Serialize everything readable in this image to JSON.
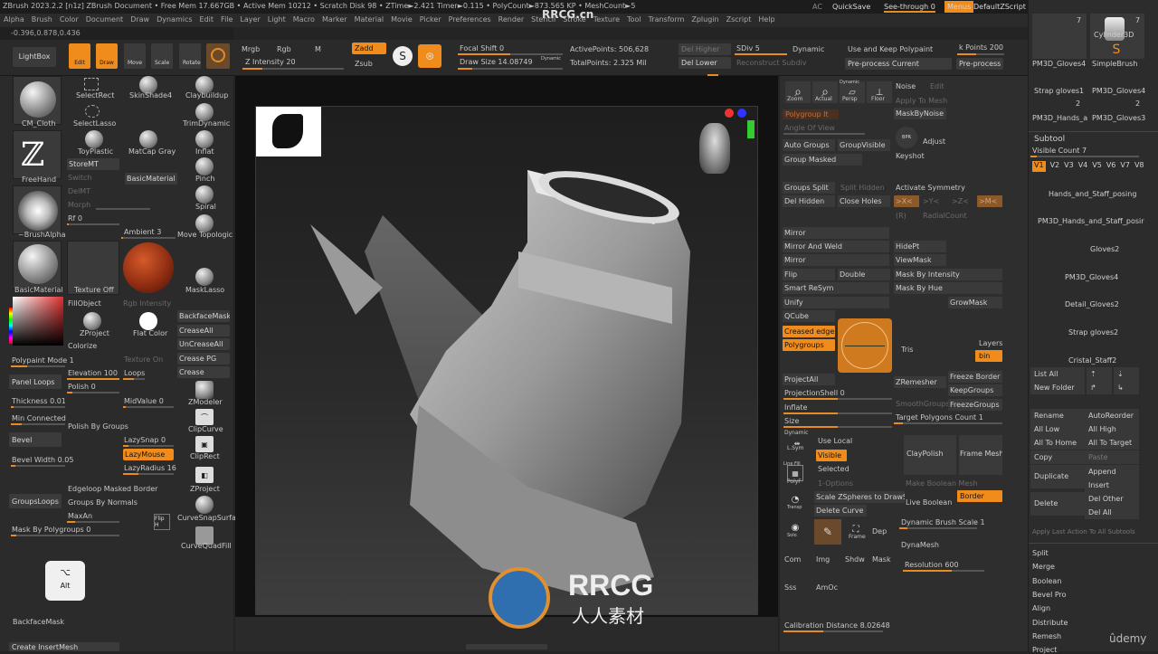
{
  "titlebar": {
    "text": "ZBrush 2023.2.2 [n1z]  ZBrush Document   • Free Mem 17.667GB • Active Mem 10212 • Scratch Disk 98 • ZTime►2.421 Timer►0.115 • PolyCount►873.565 KP • MeshCount►5",
    "ac": "AC",
    "quicksave": "QuickSave",
    "seethrough": "See-through",
    "seethrough_value": "0",
    "menus": "Menus",
    "defaultzscript": "DefaultZScript"
  },
  "menubar": [
    "Alpha",
    "Brush",
    "Color",
    "Document",
    "Draw",
    "Dynamics",
    "Edit",
    "File",
    "Layer",
    "Light",
    "Macro",
    "Marker",
    "Material",
    "Movie",
    "Picker",
    "Preferences",
    "Render",
    "Stencil",
    "Stroke",
    "Texture",
    "Tool",
    "Transform",
    "Zplugin",
    "Zscript",
    "Help"
  ],
  "coords": "-0.396,0.878,0.436",
  "toolbar": {
    "lightbox": "LightBox",
    "edit": "Edit",
    "draw": "Draw",
    "move": "Move",
    "scale": "Scale",
    "rotate": "Rotate",
    "mrgb": "Mrgb",
    "rgb": "Rgb",
    "m": "M",
    "zadd": "Zadd",
    "zsub": "Zsub",
    "z_intensity": "Z Intensity 20",
    "focal_shift": "Focal Shift 0",
    "draw_size": "Draw Size 14.08749",
    "dynamic_small": "Dynamic",
    "active_points": "ActivePoints: 506,628",
    "total_points": "TotalPoints: 2.325 Mil",
    "del_higher": "Del Higher",
    "del_lower": "Del Lower",
    "sdiv": "SDiv 5",
    "dynamic": "Dynamic",
    "reconstruct": "Reconstruct Subdiv",
    "use_keep_polypaint": "Use and Keep Polypaint",
    "preprocess_current": "Pre-process Current",
    "k_points": "k Points 200",
    "preprocess": "Pre-process /"
  },
  "left": {
    "cm_cloth": "CM_Cloth",
    "select_rect": "SelectRect",
    "skinshade4": "SkinShade4",
    "claybuildup": "Claybuildup",
    "select_lasso": "SelectLasso",
    "trimdynamic": "TrimDynamic",
    "freehand": "FreeHand",
    "toyplastic": "ToyPlastic",
    "matcapgray": "MatCap Gray",
    "inflat": "Inflat",
    "storemt": "StoreMT",
    "switch": "Switch",
    "basicmaterial": "BasicMaterial",
    "pinch": "Pinch",
    "delmt": "DelMT",
    "morph": "Morph",
    "spiral": "Spiral",
    "rf": "Rf 0",
    "brushalpha": "~BrushAlpha",
    "ambient": "Ambient 3",
    "move_topologic": "Move Topologic",
    "basicmaterial2": "BasicMaterial",
    "texture_off": "Texture Off",
    "masklasso": "MaskLasso",
    "fillobject": "FillObject",
    "rgb_intensity": "Rgb Intensity",
    "zproject": "ZProject",
    "flat_color": "Flat Color",
    "backfacemask": "BackfaceMask",
    "colorize": "Colorize",
    "crease_all": "CreaseAll",
    "uncrease_all": "UnCreaseAll",
    "crease_pg": "Crease PG",
    "crease": "Crease",
    "polypaint_mode": "Polypaint Mode 1",
    "texture_on": "Texture On",
    "panel_loops": "Panel Loops",
    "elevation": "Elevation 100",
    "loops": "Loops",
    "polish": "Polish 0",
    "thickness": "Thickness 0.01",
    "midvalue": "MidValue 0",
    "zmodeler": "ZModeler",
    "min_connected": "Min Connected",
    "polish_by_groups": "Polish By Groups",
    "clipcurve": "ClipCurve",
    "bevel": "Bevel",
    "lazysnap": "LazySnap 0",
    "lazymouse": "LazyMouse",
    "cliprect": "ClipRect",
    "bevel_width": "Bevel Width 0.05",
    "lazyradius": "LazyRadius 16",
    "edgeloop_masked": "Edgeloop Masked Border",
    "zproject2": "ZProject",
    "groupsloops": "GroupsLoops",
    "groups_by_normals": "Groups By Normals",
    "curvesnapsurf": "CurveSnapSurfa",
    "maxan": "MaxAn",
    "mask_by_polygroups": "Mask By Polygroups 0",
    "flip_h": "Flip H",
    "curvequadfill": "CurveQuadFill",
    "alt_key": "Alt",
    "alt_symbol": "⌥",
    "backfacemask_bottom": "BackfaceMask",
    "create_insertmesh": "Create InsertMesh"
  },
  "right": {
    "zoom": "Zoom",
    "actual": "Actual",
    "persp": "Persp",
    "dynamic": "Dynamic",
    "floor": "Floor",
    "noise": "Noise",
    "edit": "Edit",
    "apply_to_mesh": "Apply To Mesh",
    "polygroupit": "Polygroup It",
    "maskbynoise": "MaskByNoise",
    "angle_of_view": "Angle Of View",
    "auto_groups": "Auto Groups",
    "groupvisible": "GroupVisible",
    "bpr": "BPR",
    "adjust": "Adjust",
    "group_masked": "Group Masked",
    "keyshot": "Keyshot",
    "groups_split": "Groups Split",
    "split_hidden": "Split Hidden",
    "activate_symmetry": "Activate Symmetry",
    "del_hidden": "Del Hidden",
    "close_holes": "Close Holes",
    "sym_x": ">X<",
    "sym_y": ">Y<",
    "sym_z": ">Z<",
    "sym_m": ">M<",
    "r": "(R)",
    "radialcount": "RadialCount",
    "mirror": "Mirror",
    "mirror_and_weld": "Mirror And Weld",
    "hidept": "HidePt",
    "mirror2": "Mirror",
    "viewmask": "ViewMask",
    "flip": "Flip",
    "double": "Double",
    "mask_by_intensity": "Mask By Intensity",
    "smart_resym": "Smart ReSym",
    "mask_by_hue": "Mask By Hue",
    "unify": "Unify",
    "growmask": "GrowMask",
    "qcube": "QCube",
    "creased_edges": "Creased edges",
    "polygroups": "Polygroups",
    "tris": "Tris",
    "layers": "Layers",
    "bin": "bin",
    "projectall": "ProjectAll",
    "zremesher": "ZRemesher",
    "freeze_border": "Freeze Border",
    "projectionshell": "ProjectionShell 0",
    "keepgroups": "KeepGroups",
    "smoothgroups": "SmoothGroups",
    "freezegroups": "FreezeGroups",
    "inflate": "Inflate",
    "size": "Size",
    "target_polygons": "Target Polygons Count 1",
    "dynamic2": "Dynamic",
    "lsym": "L.Sym",
    "use_local": "Use Local",
    "visible": "Visible",
    "claypolish": "ClayPolish",
    "frame_mesh": "Frame Mesh",
    "selected": "Selected",
    "line_fill": "Line Fill",
    "polyf": "PolyF",
    "options": "1-Options",
    "make_boolean_mesh": "Make Boolean Mesh",
    "scale_zspheres": "Scale ZSpheres to DrawSize",
    "live_boolean": "Live Boolean",
    "border": "Border",
    "transp": "Transp",
    "delete_curve": "Delete Curve",
    "dynamic_brush_scale": "Dynamic Brush Scale 1",
    "solo": "Solo",
    "frame": "Frame",
    "dep": "Dep",
    "dynamesh": "DynaMesh",
    "resolution": "Resolution 600",
    "com": "Com",
    "img": "Img",
    "shdw": "Shdw",
    "mask": "Mask",
    "sss": "Sss",
    "amoc": "AmOc",
    "calibration_distance": "Calibration Distance 8.02648"
  },
  "farright": {
    "tool_count_1": "7",
    "tool_count_2": "7",
    "cylinder3d": "Cylinder3D",
    "pm3d_gloves4_a": "PM3D_Gloves4",
    "simplebrush": "SimpleBrush",
    "strap_gloves1": "Strap gloves1",
    "pm3d_gloves4_b": "PM3D_Gloves4",
    "pm3d_hands": "PM3D_Hands_a",
    "pm3d_gloves3": "PM3D_Gloves3",
    "num_2a": "2",
    "num_2b": "2",
    "subtool": "Subtool",
    "visible_count": "Visible Count 7",
    "v_levels": [
      "V1",
      "V2",
      "V3",
      "V4",
      "V5",
      "V6",
      "V7",
      "V8"
    ],
    "subtools": [
      "Hands_and_Staff_posing",
      "PM3D_Hands_and_Staff_posir",
      "Gloves2",
      "PM3D_Gloves4",
      "Detail_Gloves2",
      "Strap gloves2",
      "Cristal_Staff2"
    ],
    "list_all": "List All",
    "new_folder": "New Folder",
    "rename": "Rename",
    "autoreorder": "AutoReorder",
    "all_low": "All Low",
    "all_high": "All High",
    "all_to_home": "All To Home",
    "all_to_target": "All To Target",
    "copy": "Copy",
    "paste": "Paste",
    "duplicate": "Duplicate",
    "append": "Append",
    "insert": "Insert",
    "delete": "Delete",
    "del_other": "Del Other",
    "del_all": "Del All",
    "apply_last_action": "Apply Last Action To All Subtools",
    "split": "Split",
    "merge": "Merge",
    "boolean": "Boolean",
    "bevel_pro": "Bevel Pro",
    "align": "Align",
    "distribute": "Distribute",
    "remesh": "Remesh",
    "project": "Project"
  },
  "watermark": {
    "brand": "RRCG",
    "sub": "人人素材",
    "top": "RRCG.cn"
  },
  "udemy": "ûdemy",
  "colors": {
    "accent": "#f08c1c",
    "panel": "#2b2b2b",
    "button": "#3b3b3b"
  }
}
